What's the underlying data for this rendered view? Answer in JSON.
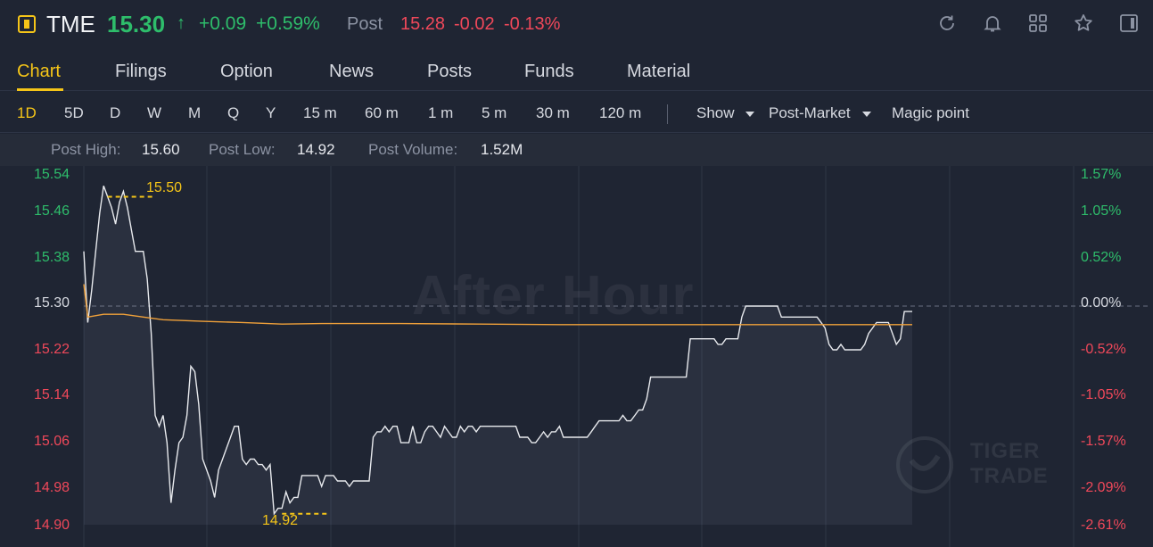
{
  "header": {
    "ticker": "TME",
    "price": "15.30",
    "price_arrow": "↑",
    "change": "+0.09",
    "change_pct": "+0.59%",
    "post_label": "Post",
    "post_price": "15.28",
    "post_change": "-0.02",
    "post_change_pct": "-0.13%",
    "icons": [
      "refresh-icon",
      "bell-icon",
      "grid-icon",
      "star-icon",
      "panel-icon"
    ]
  },
  "tabs": [
    {
      "label": "Chart",
      "active": true
    },
    {
      "label": "Filings"
    },
    {
      "label": "Option"
    },
    {
      "label": "News"
    },
    {
      "label": "Posts"
    },
    {
      "label": "Funds"
    },
    {
      "label": "Material"
    }
  ],
  "periods": [
    "1D",
    "5D",
    "D",
    "W",
    "M",
    "Q",
    "Y",
    "15 m",
    "60 m",
    "1 m",
    "5 m",
    "30 m",
    "120 m"
  ],
  "options": {
    "show": "Show",
    "post_market": "Post-Market",
    "magic_point": "Magic point"
  },
  "stats": {
    "post_high_label": "Post High:",
    "post_high": "15.60",
    "post_low_label": "Post Low:",
    "post_low": "14.92",
    "post_volume_label": "Post Volume:",
    "post_volume": "1.52M"
  },
  "chart_data": {
    "type": "line",
    "left_ticks": [
      "15.54",
      "15.46",
      "15.38",
      "15.30",
      "15.22",
      "15.14",
      "15.06",
      "14.98",
      "14.90"
    ],
    "right_ticks": [
      "1.57%",
      "1.05%",
      "0.52%",
      "0.00%",
      "-0.52%",
      "-1.05%",
      "-1.57%",
      "-2.09%",
      "-2.61%"
    ],
    "ylim": [
      14.9,
      15.54
    ],
    "reference_price": 15.3,
    "watermark": "After Hour",
    "logo": [
      "TIGER",
      "TRADE"
    ],
    "annotations": [
      {
        "label": "15.50",
        "x": 6,
        "y": 15.5
      },
      {
        "label": "14.92",
        "x": 50,
        "y": 14.92
      }
    ],
    "colors": {
      "price_line": "#e8eaee",
      "avg_line": "#f0a13a",
      "up": "#2ebd6b",
      "down": "#f0485a",
      "annotation": "#f5c518"
    },
    "series": [
      {
        "style": "price",
        "values": [
          [
            0,
            15.4
          ],
          [
            1,
            15.27
          ],
          [
            2,
            15.33
          ],
          [
            3,
            15.4
          ],
          [
            4,
            15.47
          ],
          [
            5,
            15.52
          ],
          [
            6,
            15.5
          ],
          [
            7,
            15.48
          ],
          [
            8,
            15.45
          ],
          [
            9,
            15.49
          ],
          [
            10,
            15.51
          ],
          [
            11,
            15.48
          ],
          [
            12,
            15.44
          ],
          [
            13,
            15.4
          ],
          [
            14,
            15.4
          ],
          [
            15,
            15.4
          ],
          [
            16,
            15.35
          ],
          [
            17,
            15.25
          ],
          [
            18,
            15.1
          ],
          [
            19,
            15.08
          ],
          [
            20,
            15.1
          ],
          [
            21,
            15.05
          ],
          [
            22,
            14.94
          ],
          [
            23,
            15.0
          ],
          [
            24,
            15.05
          ],
          [
            25,
            15.06
          ],
          [
            26,
            15.1
          ],
          [
            27,
            15.19
          ],
          [
            28,
            15.18
          ],
          [
            29,
            15.12
          ],
          [
            30,
            15.02
          ],
          [
            31,
            15.0
          ],
          [
            32,
            14.98
          ],
          [
            33,
            14.95
          ],
          [
            34,
            15.0
          ],
          [
            35,
            15.02
          ],
          [
            36,
            15.04
          ],
          [
            37,
            15.06
          ],
          [
            38,
            15.08
          ],
          [
            39,
            15.08
          ],
          [
            40,
            15.02
          ],
          [
            41,
            15.01
          ],
          [
            42,
            15.02
          ],
          [
            43,
            15.02
          ],
          [
            44,
            15.01
          ],
          [
            45,
            15.01
          ],
          [
            46,
            15.0
          ],
          [
            47,
            15.01
          ],
          [
            48,
            14.92
          ],
          [
            49,
            14.93
          ],
          [
            50,
            14.93
          ],
          [
            51,
            14.96
          ],
          [
            52,
            14.94
          ],
          [
            53,
            14.95
          ],
          [
            54,
            14.95
          ],
          [
            55,
            14.99
          ],
          [
            56,
            14.99
          ],
          [
            57,
            14.99
          ],
          [
            58,
            14.99
          ],
          [
            59,
            14.99
          ],
          [
            60,
            14.97
          ],
          [
            61,
            14.99
          ],
          [
            62,
            14.99
          ],
          [
            63,
            14.99
          ],
          [
            64,
            14.98
          ],
          [
            65,
            14.98
          ],
          [
            66,
            14.98
          ],
          [
            67,
            14.97
          ],
          [
            68,
            14.98
          ],
          [
            69,
            14.98
          ],
          [
            70,
            14.98
          ],
          [
            71,
            14.98
          ],
          [
            72,
            14.98
          ],
          [
            73,
            15.06
          ],
          [
            74,
            15.07
          ],
          [
            75,
            15.07
          ],
          [
            76,
            15.08
          ],
          [
            77,
            15.07
          ],
          [
            78,
            15.08
          ],
          [
            79,
            15.08
          ],
          [
            80,
            15.05
          ],
          [
            81,
            15.05
          ],
          [
            82,
            15.05
          ],
          [
            83,
            15.08
          ],
          [
            84,
            15.05
          ],
          [
            85,
            15.05
          ],
          [
            86,
            15.07
          ],
          [
            87,
            15.08
          ],
          [
            88,
            15.08
          ],
          [
            89,
            15.07
          ],
          [
            90,
            15.06
          ],
          [
            91,
            15.08
          ],
          [
            92,
            15.07
          ],
          [
            93,
            15.06
          ],
          [
            94,
            15.06
          ],
          [
            95,
            15.08
          ],
          [
            96,
            15.07
          ],
          [
            97,
            15.08
          ],
          [
            98,
            15.08
          ],
          [
            99,
            15.07
          ],
          [
            100,
            15.08
          ],
          [
            101,
            15.08
          ],
          [
            102,
            15.08
          ],
          [
            103,
            15.08
          ],
          [
            104,
            15.08
          ],
          [
            105,
            15.08
          ],
          [
            106,
            15.08
          ],
          [
            107,
            15.08
          ],
          [
            108,
            15.08
          ],
          [
            109,
            15.08
          ],
          [
            110,
            15.06
          ],
          [
            111,
            15.06
          ],
          [
            112,
            15.06
          ],
          [
            113,
            15.05
          ],
          [
            114,
            15.05
          ],
          [
            115,
            15.06
          ],
          [
            116,
            15.07
          ],
          [
            117,
            15.06
          ],
          [
            118,
            15.07
          ],
          [
            119,
            15.07
          ],
          [
            120,
            15.08
          ],
          [
            121,
            15.06
          ],
          [
            122,
            15.06
          ],
          [
            123,
            15.06
          ],
          [
            124,
            15.06
          ],
          [
            125,
            15.06
          ],
          [
            126,
            15.06
          ],
          [
            127,
            15.06
          ],
          [
            128,
            15.07
          ],
          [
            129,
            15.08
          ],
          [
            130,
            15.09
          ],
          [
            131,
            15.09
          ],
          [
            132,
            15.09
          ],
          [
            133,
            15.09
          ],
          [
            134,
            15.09
          ],
          [
            135,
            15.09
          ],
          [
            136,
            15.1
          ],
          [
            137,
            15.09
          ],
          [
            138,
            15.09
          ],
          [
            139,
            15.1
          ],
          [
            140,
            15.11
          ],
          [
            141,
            15.11
          ],
          [
            142,
            15.13
          ],
          [
            143,
            15.17
          ],
          [
            144,
            15.17
          ],
          [
            145,
            15.17
          ],
          [
            146,
            15.17
          ],
          [
            147,
            15.17
          ],
          [
            148,
            15.17
          ],
          [
            149,
            15.17
          ],
          [
            150,
            15.17
          ],
          [
            151,
            15.17
          ],
          [
            152,
            15.17
          ],
          [
            153,
            15.24
          ],
          [
            154,
            15.24
          ],
          [
            155,
            15.24
          ],
          [
            156,
            15.24
          ],
          [
            157,
            15.24
          ],
          [
            158,
            15.24
          ],
          [
            159,
            15.24
          ],
          [
            160,
            15.23
          ],
          [
            161,
            15.23
          ],
          [
            162,
            15.24
          ],
          [
            163,
            15.24
          ],
          [
            164,
            15.24
          ],
          [
            165,
            15.24
          ],
          [
            166,
            15.28
          ],
          [
            167,
            15.3
          ],
          [
            168,
            15.3
          ],
          [
            169,
            15.3
          ],
          [
            170,
            15.3
          ],
          [
            171,
            15.3
          ],
          [
            172,
            15.3
          ],
          [
            173,
            15.3
          ],
          [
            174,
            15.3
          ],
          [
            175,
            15.3
          ],
          [
            176,
            15.28
          ],
          [
            177,
            15.28
          ],
          [
            178,
            15.28
          ],
          [
            179,
            15.28
          ],
          [
            180,
            15.28
          ],
          [
            181,
            15.28
          ],
          [
            182,
            15.28
          ],
          [
            183,
            15.28
          ],
          [
            184,
            15.28
          ],
          [
            185,
            15.28
          ],
          [
            186,
            15.27
          ],
          [
            187,
            15.26
          ],
          [
            188,
            15.23
          ],
          [
            189,
            15.22
          ],
          [
            190,
            15.22
          ],
          [
            191,
            15.23
          ],
          [
            192,
            15.22
          ],
          [
            193,
            15.22
          ],
          [
            194,
            15.22
          ],
          [
            195,
            15.22
          ],
          [
            196,
            15.22
          ],
          [
            197,
            15.23
          ],
          [
            198,
            15.25
          ],
          [
            199,
            15.26
          ],
          [
            200,
            15.27
          ],
          [
            201,
            15.27
          ],
          [
            202,
            15.27
          ],
          [
            203,
            15.27
          ],
          [
            204,
            15.25
          ],
          [
            205,
            15.23
          ],
          [
            206,
            15.24
          ],
          [
            207,
            15.29
          ],
          [
            208,
            15.29
          ],
          [
            209,
            15.29
          ]
        ]
      },
      {
        "style": "average",
        "values": [
          [
            0,
            15.34
          ],
          [
            1,
            15.28
          ],
          [
            5,
            15.285
          ],
          [
            10,
            15.285
          ],
          [
            15,
            15.28
          ],
          [
            20,
            15.275
          ],
          [
            30,
            15.272
          ],
          [
            40,
            15.27
          ],
          [
            50,
            15.267
          ],
          [
            60,
            15.268
          ],
          [
            80,
            15.268
          ],
          [
            100,
            15.267
          ],
          [
            120,
            15.266
          ],
          [
            140,
            15.266
          ],
          [
            160,
            15.266
          ],
          [
            180,
            15.266
          ],
          [
            209,
            15.266
          ]
        ]
      }
    ]
  }
}
